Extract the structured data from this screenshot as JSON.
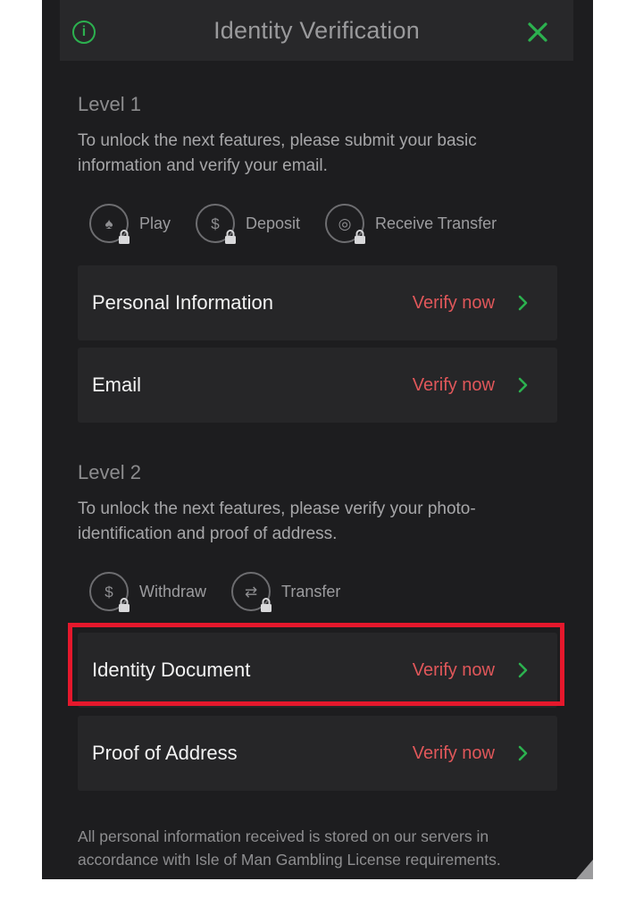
{
  "header": {
    "title": "Identity Verification",
    "info_icon": "info-circle-icon",
    "close_icon": "close-icon",
    "accent_color": "#2cb14f"
  },
  "level1": {
    "title": "Level 1",
    "description": "To unlock the next features, please submit your basic information and verify your email.",
    "features": [
      {
        "label": "Play",
        "icon": "cards-icon"
      },
      {
        "label": "Deposit",
        "icon": "deposit-icon"
      },
      {
        "label": "Receive Transfer",
        "icon": "receive-transfer-icon"
      }
    ],
    "items": [
      {
        "label": "Personal Information",
        "action": "Verify now"
      },
      {
        "label": "Email",
        "action": "Verify now"
      }
    ]
  },
  "level2": {
    "title": "Level 2",
    "description": "To unlock the next features, please verify your photo-identification and proof of address.",
    "features": [
      {
        "label": "Withdraw",
        "icon": "withdraw-icon"
      },
      {
        "label": "Transfer",
        "icon": "transfer-icon"
      }
    ],
    "items": [
      {
        "label": "Identity Document",
        "action": "Verify now"
      },
      {
        "label": "Proof of Address",
        "action": "Verify now"
      }
    ]
  },
  "footer": {
    "text": "All personal information received is stored on our servers in accordance with Isle of Man Gambling License requirements."
  },
  "colors": {
    "action": "#e0575a",
    "chevron": "#2cb14f",
    "highlight": "#e5182c"
  }
}
